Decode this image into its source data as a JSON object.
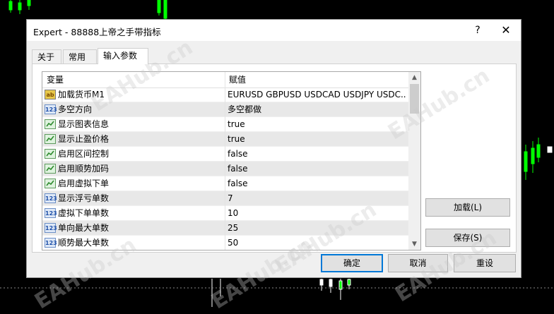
{
  "window": {
    "title": "Expert - 88888上帝之手带指标",
    "help_glyph": "?",
    "close_glyph": "✕"
  },
  "tabs": [
    {
      "label": "关于",
      "active": false
    },
    {
      "label": "常用",
      "active": false
    },
    {
      "label": "输入参数",
      "active": true
    }
  ],
  "grid": {
    "columns": [
      "变量",
      "赋值"
    ],
    "rows": [
      {
        "icon": "string-icon",
        "icon_text": "ab",
        "name": "加载货币M1",
        "value": "EURUSD GBPUSD USDCAD USDJPY USDC..."
      },
      {
        "icon": "number-icon",
        "icon_text": "123",
        "name": "多空方向",
        "value": "多空都做"
      },
      {
        "icon": "bool-icon",
        "name": "显示图表信息",
        "value": "true"
      },
      {
        "icon": "bool-icon",
        "name": "显示止盈价格",
        "value": "true"
      },
      {
        "icon": "bool-icon",
        "name": "启用区间控制",
        "value": "false"
      },
      {
        "icon": "bool-icon",
        "name": "启用顺势加码",
        "value": "false"
      },
      {
        "icon": "bool-icon",
        "name": "启用虚拟下单",
        "value": "false"
      },
      {
        "icon": "number-icon",
        "icon_text": "123",
        "name": "显示浮亏单数",
        "value": "7"
      },
      {
        "icon": "number-icon",
        "icon_text": "123",
        "name": "虚拟下单单数",
        "value": "10"
      },
      {
        "icon": "number-icon",
        "icon_text": "123",
        "name": "单向最大单数",
        "value": "25"
      },
      {
        "icon": "number-icon",
        "icon_text": "123",
        "name": "顺势最大单数",
        "value": "50"
      }
    ]
  },
  "buttons": {
    "load": "加载(L)",
    "save": "保存(S)",
    "ok": "确定",
    "cancel": "取消",
    "reset": "重设"
  },
  "watermark": "EAHub.cn",
  "colors": {
    "background": "#000000",
    "candle_up": "#00ff00",
    "candle_wick": "#ffffff",
    "primary_border": "#0078d7",
    "icon_string": "#e8c84a",
    "icon_number": "#1d4fa8",
    "icon_bool": "#2e8b2e"
  }
}
